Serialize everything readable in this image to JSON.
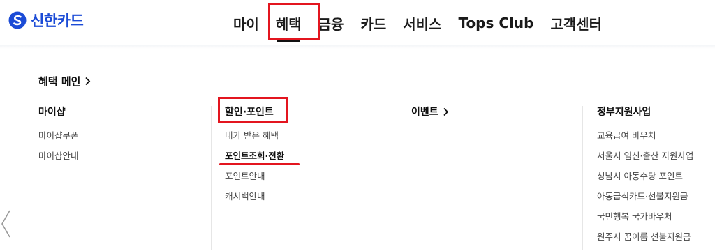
{
  "logo": {
    "text": "신한카드",
    "icon": "shinhan-logo-icon",
    "color": "#1b4bd6"
  },
  "gnb": [
    {
      "label": "마이"
    },
    {
      "label": "혜택",
      "active": true
    },
    {
      "label": "금융"
    },
    {
      "label": "카드"
    },
    {
      "label": "서비스"
    },
    {
      "label": "Tops Club"
    },
    {
      "label": "고객센터"
    }
  ],
  "mega": {
    "main_link": "혜택 메인",
    "columns": [
      {
        "title": "마이샵",
        "items": [
          "마이샵쿠폰",
          "마이샵안내"
        ]
      },
      {
        "title": "할인·포인트",
        "items": [
          "내가 받은 혜택",
          "포인트조회·전환",
          "포인트안내",
          "캐시백안내"
        ],
        "current_item": "포인트조회·전환"
      },
      {
        "title": "이벤트",
        "items": []
      },
      {
        "title": "정부지원사업",
        "items": [
          "교육급여 바우처",
          "서울시 임신·출산 지원사업",
          "성남시 아동수당 포인트",
          "아동급식카드·선불지원금",
          "국민행복 국가바우처",
          "원주시 꿈이룸 선불지원금"
        ]
      }
    ]
  },
  "colors": {
    "accent": "#e3151f",
    "brand": "#1b4bd6"
  }
}
